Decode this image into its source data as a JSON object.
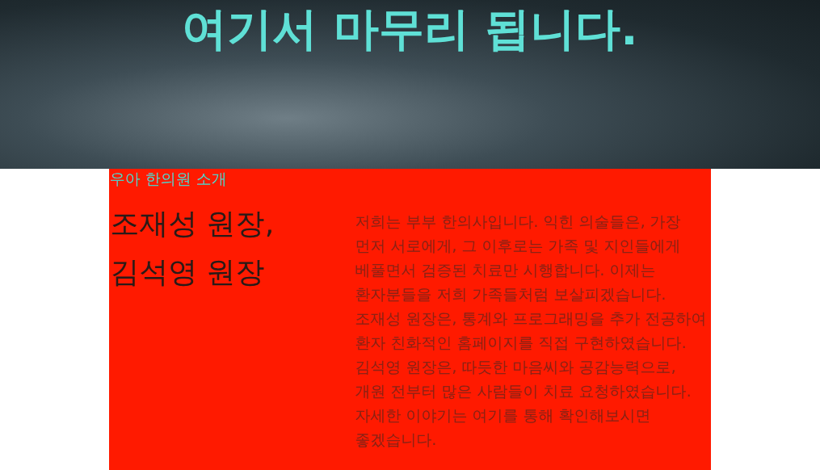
{
  "hero": {
    "title": "여기서 마무리 됩니다."
  },
  "intro": {
    "label": "우아 한의원 소개",
    "names": [
      "조재성 원장,",
      "김석영 원장"
    ],
    "body": "저희는 부부 한의사입니다. 익힌 의술들은, 가장 먼저 서로에게, 그 이후로는 가족 및 지인들에게 베풀면서 검증된 치료만 시행합니다. 이제는 환자분들을 저희 가족들처럼 보살피겠습니다. 조재성 원장은, 통계와 프로그래밍을 추가 전공하여 환자 친화적인 홈페이지를 직접 구현하였습니다. 김석영 원장은, 따듯한 마음씨와 공감능력으로, 개원 전부터 많은 사람들이 치료 요청하였습니다. 자세한 이야기는 여기를 통해 확인해보시면 좋겠습니다."
  }
}
